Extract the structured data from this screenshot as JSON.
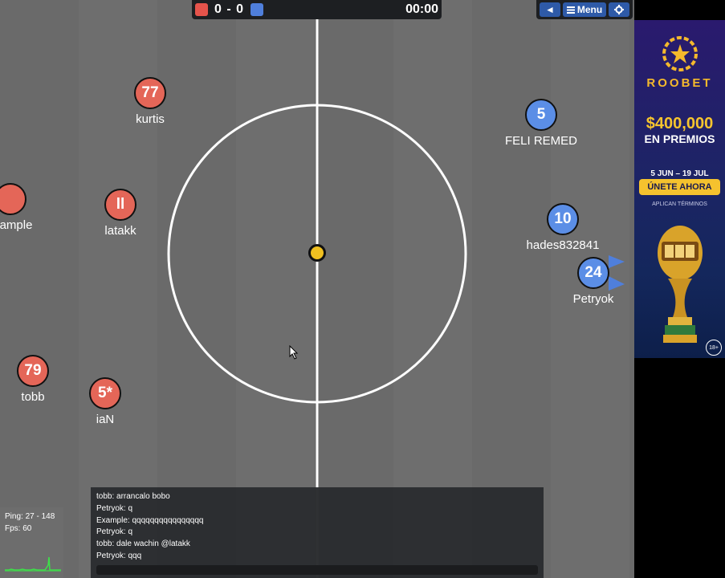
{
  "scoreboard": {
    "red_score": "0",
    "blue_score": "0",
    "separator": "-",
    "time": "00:00",
    "red_color": "#e5534b",
    "blue_color": "#4f7fdc"
  },
  "topbar": {
    "back_icon": "◄",
    "menu_label": "Menu",
    "menu_icon": "hamburger-icon",
    "settings_icon": "gear-icon"
  },
  "players": [
    {
      "team": "red",
      "number": "77",
      "name": "kurtis"
    },
    {
      "team": "red",
      "number": "",
      "name": "ample"
    },
    {
      "team": "red",
      "number": "ll",
      "name": "latakk"
    },
    {
      "team": "red",
      "number": "79",
      "name": "tobb"
    },
    {
      "team": "red",
      "number": "5*",
      "name": "iaN"
    },
    {
      "team": "blue",
      "number": "5",
      "name": "FELI REMED"
    },
    {
      "team": "blue",
      "number": "10",
      "name": "hades832841"
    },
    {
      "team": "blue",
      "number": "24",
      "name": "Petryok"
    }
  ],
  "chat": {
    "lines": [
      "tobb: arrancalo bobo",
      "Petryok: q",
      "Example: qqqqqqqqqqqqqqqq",
      "Petryok: q",
      "tobb: dale wachin @latakk",
      "Petryok: qqq"
    ]
  },
  "stats": {
    "ping": "Ping: 27 - 148",
    "fps": "Fps: 60"
  },
  "ad": {
    "brand": "ROOBET",
    "amount": "$400,000",
    "premios": "EN PREMIOS",
    "dates": "5 JUN – 19 JUL",
    "cta": "ÚNETE AHORA",
    "terms": "APLICAN TÉRMINOS",
    "age": "18+"
  }
}
